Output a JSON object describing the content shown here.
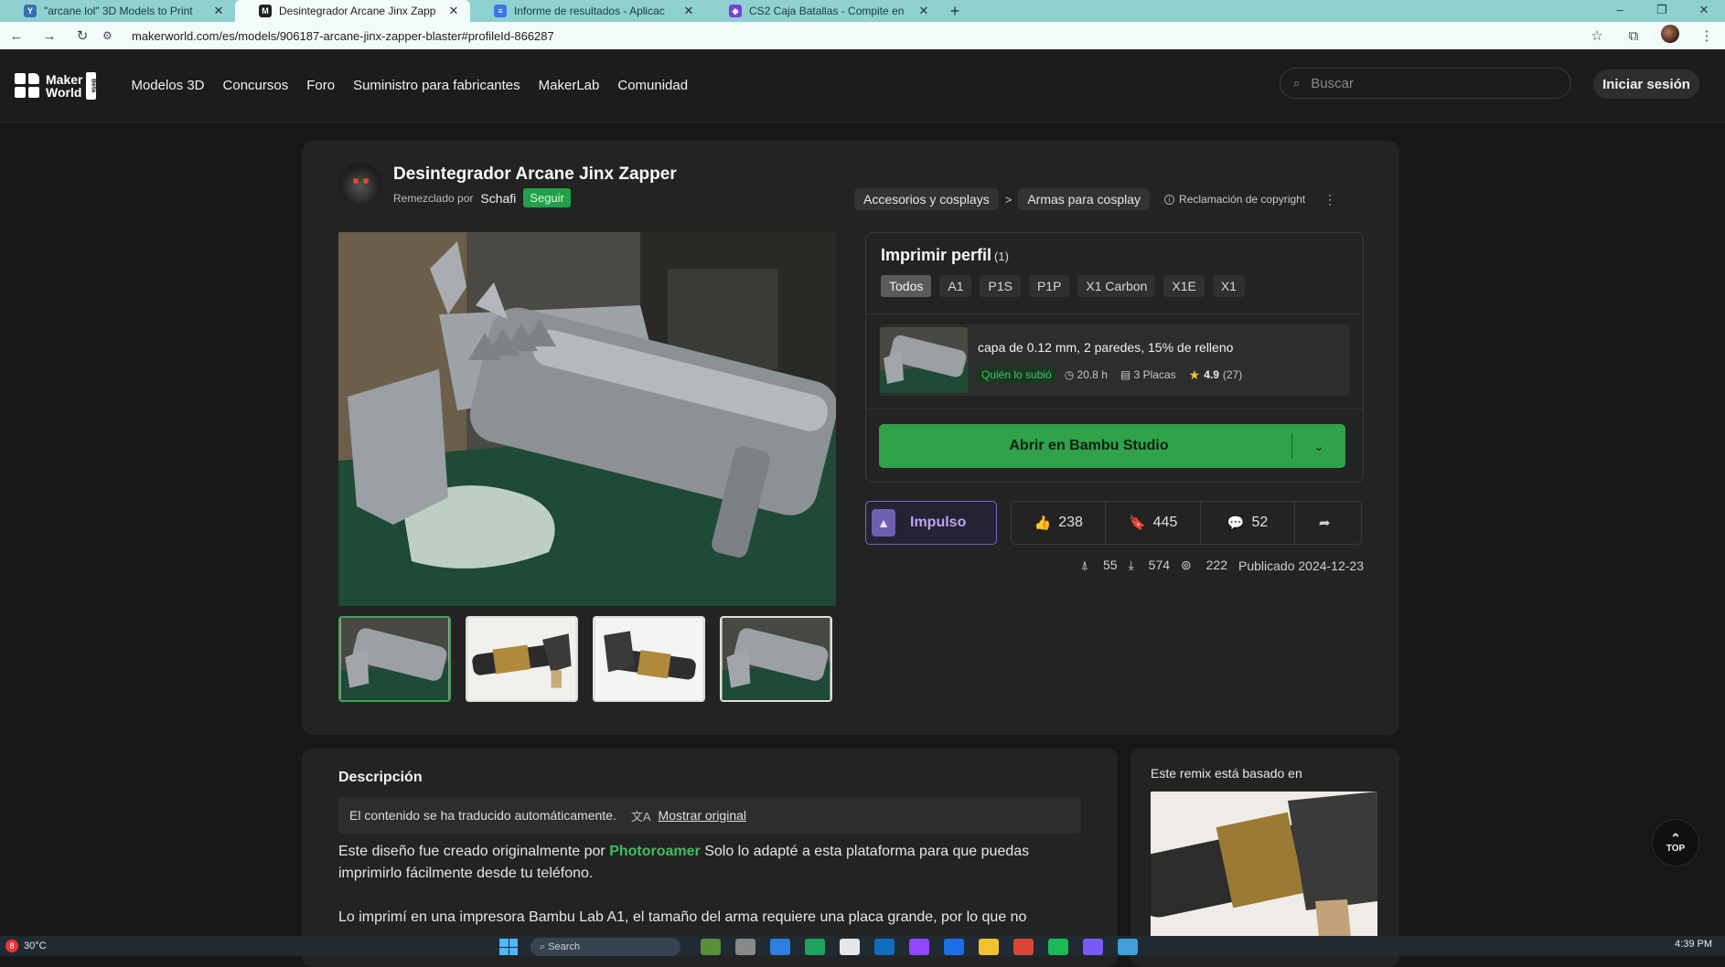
{
  "browser": {
    "tabs": [
      {
        "title": "\"arcane lol\" 3D Models to Print",
        "favicon_letter": "Y",
        "favicon_color": "#3a6fb0",
        "active": false
      },
      {
        "title": "Desintegrador Arcane Jinx Zapp",
        "favicon_letter": "M",
        "favicon_color": "#222222",
        "active": true
      },
      {
        "title": "Informe de resultados - Aplicac",
        "favicon_letter": "≡",
        "favicon_color": "#3b78e7",
        "active": false
      },
      {
        "title": "CS2 Caja Batallas - Compite en",
        "favicon_letter": "◆",
        "favicon_color": "#7a3fd6",
        "active": false
      }
    ],
    "new_tab": "+",
    "window_controls": [
      "–",
      "❐",
      "✕"
    ],
    "url": "makerworld.com/es/models/906187-arcane-jinx-zapper-blaster#profileId-866287"
  },
  "header": {
    "logo_line1": "Maker",
    "logo_line2": "World",
    "beta": "Beta",
    "nav": [
      "Modelos 3D",
      "Concursos",
      "Foro",
      "Suministro para fabricantes",
      "MakerLab",
      "Comunidad"
    ],
    "search_placeholder": "Buscar",
    "login": "Iniciar sesión"
  },
  "model": {
    "title": "Desintegrador Arcane Jinx Zapper",
    "remix_by": "Remezclado por",
    "author": "Schafi",
    "follow": "Seguir",
    "breadcrumb": [
      "Accesorios y cosplays",
      "Armas para cosplay"
    ],
    "breadcrumb_sep": ">",
    "copyright": "Reclamación de copyright",
    "menu": "⋮"
  },
  "profile": {
    "title": "Imprimir perfil",
    "count": "(1)",
    "printers": [
      "Todos",
      "A1",
      "P1S",
      "P1P",
      "X1 Carbon",
      "X1E",
      "X1"
    ],
    "selected_printer": "Todos",
    "item": {
      "name": "capa de 0.12 mm, 2 paredes, 15% de relleno",
      "badge": "Quién lo subió",
      "time": "20.8 h",
      "plates": "3 Placas",
      "rating": "4.9",
      "rating_count": "(27)"
    },
    "open_button": "Abrir en Bambu Studio"
  },
  "actions": {
    "boost": "Impulso",
    "likes": "238",
    "collects": "445",
    "comments": "52"
  },
  "meta": {
    "boosts": "55",
    "downloads": "574",
    "prints": "222",
    "published": "Publicado 2024-12-23"
  },
  "description": {
    "heading": "Descripción",
    "translated_notice": "El contenido se ha traducido automáticamente.",
    "show_original": "Mostrar original",
    "p1_before": "Este diseño fue creado originalmente por ",
    "p1_link": "Photoroamer",
    "p1_after": " Solo lo adapté a esta plataforma para que puedas imprimirlo fácilmente desde tu teléfono.",
    "p2": "Lo imprimí en una impresora Bambu Lab A1, el tamaño del arma requiere una placa grande, por lo que no"
  },
  "remix": {
    "heading": "Este remix está basado en"
  },
  "top_button": "TOP",
  "taskbar": {
    "temperature": "30°C",
    "weather_badge": "8",
    "search": "Search",
    "clock": "4:39 PM"
  }
}
